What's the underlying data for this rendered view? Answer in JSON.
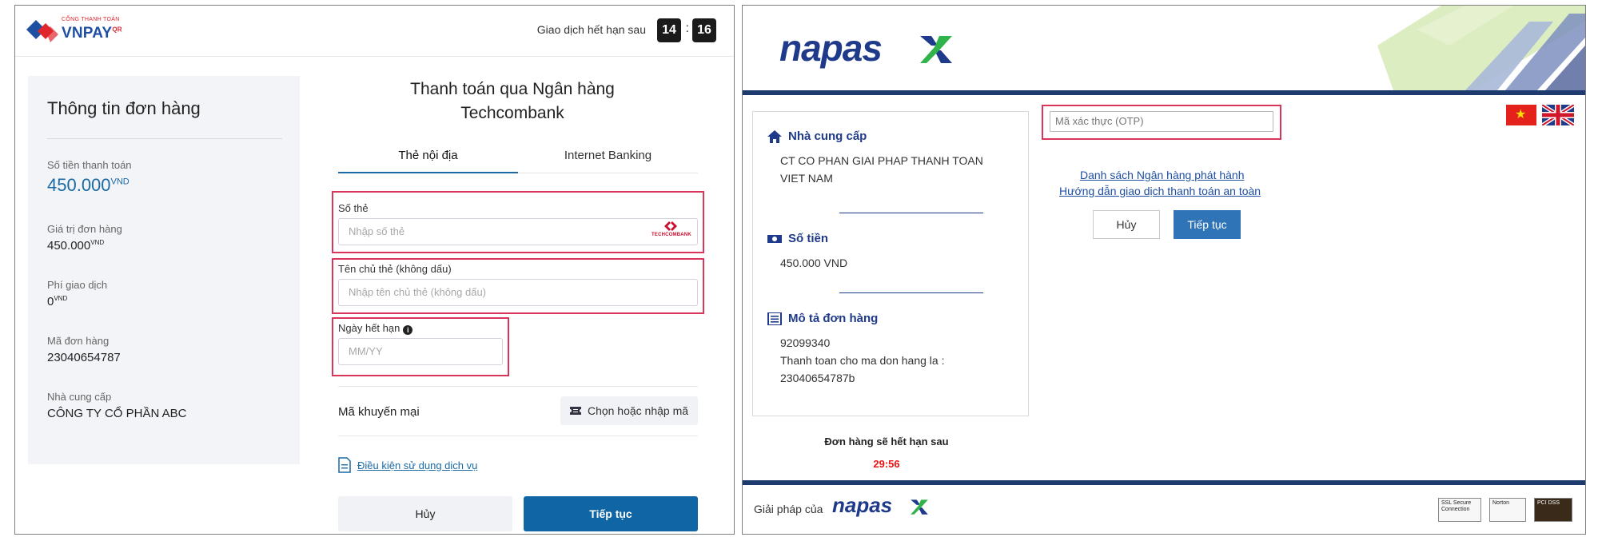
{
  "vnpay": {
    "logo_sub": "CỔNG THANH TOÁN",
    "logo_main": "VNPAY",
    "logo_qr": "QR",
    "timer_label": "Giao dịch hết hạn sau",
    "timer_minutes": "14",
    "timer_colon": ":",
    "timer_seconds": "16",
    "order": {
      "title": "Thông tin đơn hàng",
      "amount_label": "Số tiền thanh toán",
      "amount_value": "450.000",
      "amount_currency": "VND",
      "order_value_label": "Giá trị đơn hàng",
      "order_value": "450.000",
      "order_value_currency": "VND",
      "fee_label": "Phí giao dịch",
      "fee_value": "0",
      "fee_currency": "VND",
      "order_id_label": "Mã đơn hàng",
      "order_id": "23040654787",
      "provider_label": "Nhà cung cấp",
      "provider": "CÔNG TY CỔ PHẦN ABC"
    },
    "pay_title_line1": "Thanh toán qua Ngân hàng",
    "pay_title_line2": "Techcombank",
    "tabs": [
      {
        "label": "Thẻ nội địa",
        "active": true
      },
      {
        "label": "Internet Banking",
        "active": false
      }
    ],
    "fields": {
      "card_number_label": "Số thẻ",
      "card_number_placeholder": "Nhập số thẻ",
      "card_holder_label": "Tên chủ thẻ (không dấu)",
      "card_holder_placeholder": "Nhập tên chủ thẻ (không dấu)",
      "expiry_label": "Ngày hết hạn",
      "expiry_placeholder": "MM/YY"
    },
    "bank_logo_text": "TECHCOMBANK",
    "promo_label": "Mã khuyến mại",
    "promo_button": "Chọn hoặc nhập mã",
    "terms_link": "Điều kiện sử dụng dịch vụ",
    "cancel_button": "Hủy",
    "continue_button": "Tiếp tục",
    "highlight_color": "#d9355a",
    "accent_color": "#1065a4"
  },
  "napas": {
    "logo": "napas",
    "provider_heading": "Nhà cung cấp",
    "provider_line1": "CT CO PHAN GIAI PHAP THANH TOAN",
    "provider_line2": "VIET NAM",
    "amount_heading": "Số tiền",
    "amount_value": "450.000 VND",
    "desc_heading": "Mô tả đơn hàng",
    "desc_line1": "92099340",
    "desc_line2": "Thanh toan cho ma don hang la :",
    "desc_line3": "23040654787b",
    "expire_label": "Đơn hàng sẽ hết hạn sau",
    "expire_time": "29:56",
    "otp_placeholder": "Mã xác thực (OTP)",
    "link_banks": "Danh sách Ngân hàng phát hành",
    "link_guide": "Hướng dẫn giao dịch thanh toán an toàn",
    "cancel_button": "Hủy",
    "continue_button": "Tiếp tục",
    "footer_label": "Giải pháp của",
    "footer_logo": "napas",
    "badge_ssl": "SSL Secure Connection",
    "badge_norton": "Norton",
    "badge_pci": "PCI DSS",
    "brand_color": "#1f3a8a"
  }
}
